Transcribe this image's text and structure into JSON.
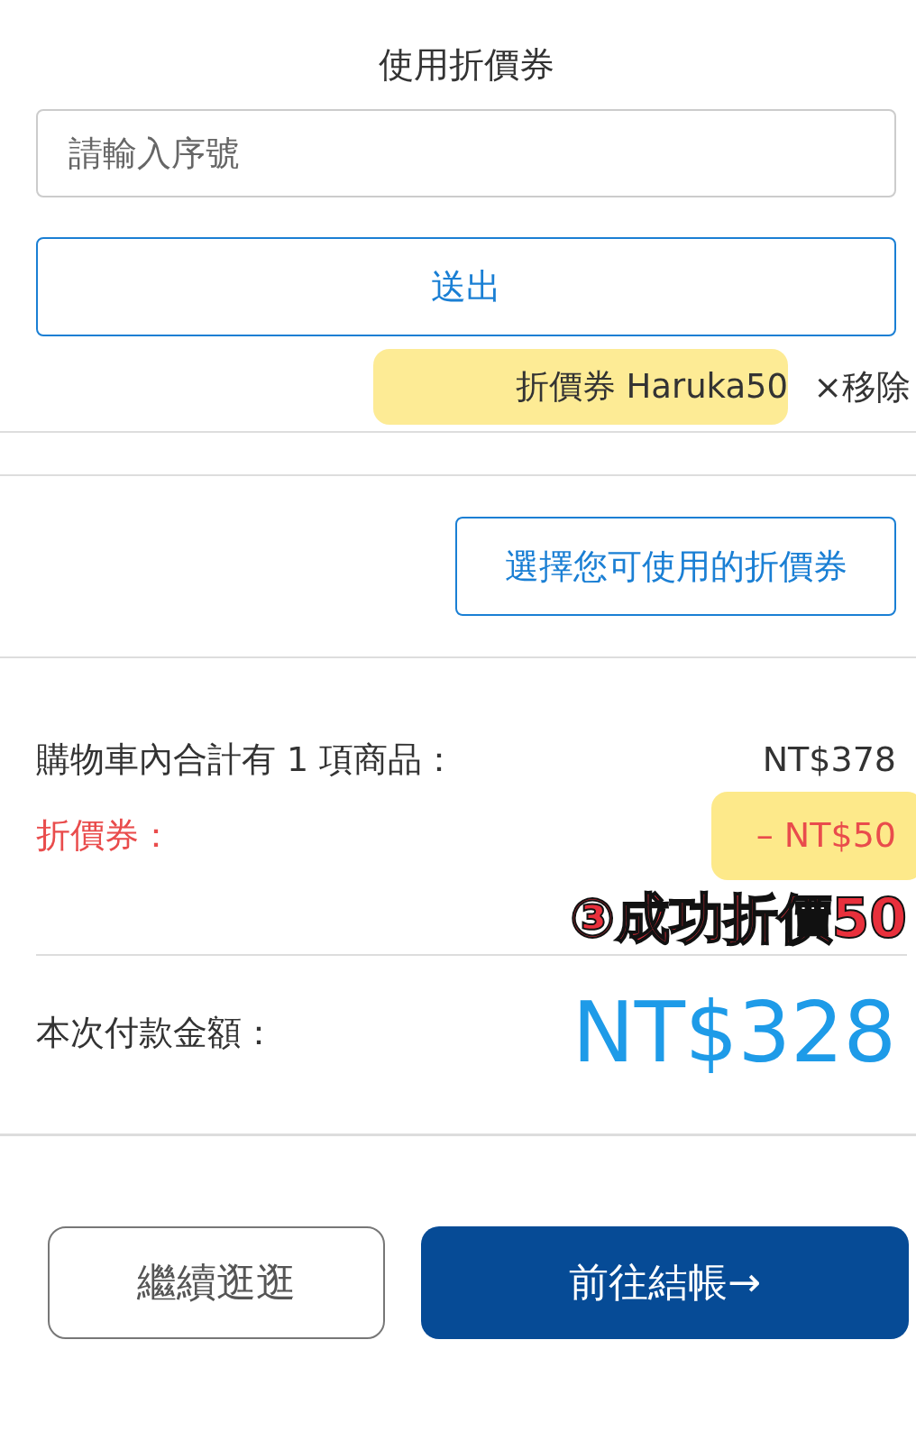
{
  "coupon_section": {
    "title": "使用折價券",
    "input": {
      "placeholder": "請輸入序號"
    },
    "submit_button": "送出",
    "applied_coupon": {
      "label": "折價券 Haruka50",
      "remove_icon": "×",
      "remove_label": "移除"
    }
  },
  "choose_coupon_button": "選擇您可使用的折價券",
  "summary": {
    "rows": [
      {
        "kind": "normal",
        "label": "購物車內合計有 1 項商品：",
        "value": "NT$378"
      },
      {
        "kind": "discount",
        "label": "折價券：",
        "value": "– NT$50"
      }
    ],
    "annotation": "③成功折價50",
    "total": {
      "label": "本次付款金額：",
      "value": "NT$328"
    }
  },
  "buttons": [
    {
      "kind": "secondary",
      "label": "繼續逛逛"
    },
    {
      "kind": "primary",
      "label": "前往結帳",
      "icon": "→"
    }
  ]
}
